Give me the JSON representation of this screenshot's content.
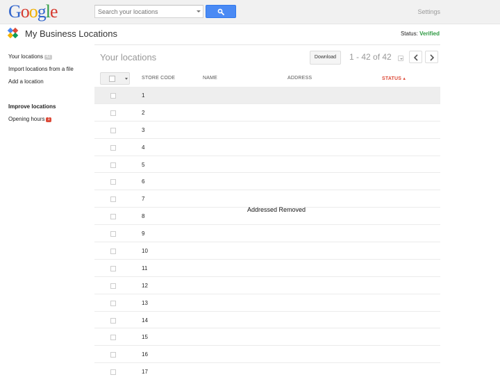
{
  "header": {
    "logo_text": "Google",
    "search": {
      "placeholder": "Search your locations"
    },
    "settings_label": "Settings"
  },
  "titlebar": {
    "title": "My Business Locations",
    "status_label": "Status:",
    "status_value": "Verified"
  },
  "sidebar": {
    "your_locations": "Your locations",
    "your_locations_count": "42",
    "import": "Import locations from a file",
    "add": "Add a location",
    "improve_heading": "Improve locations",
    "opening_hours": "Opening hours",
    "opening_hours_alert": "1"
  },
  "main": {
    "title": "Your locations",
    "download_label": "Download",
    "pager_text": "1 - 42 of 42",
    "columns": {
      "store_code": "STORE CODE",
      "name": "NAME",
      "address": "ADDRESS",
      "status": "STATUS"
    },
    "rows": [
      "1",
      "2",
      "3",
      "4",
      "5",
      "6",
      "7",
      "8",
      "9",
      "10",
      "11",
      "12",
      "13",
      "14",
      "15",
      "16",
      "17"
    ],
    "overlay_text": "Addressed Removed"
  },
  "colors": {
    "accent_blue": "#4a8af4",
    "verified_green": "#2d9941",
    "status_red": "#dd4b39"
  }
}
